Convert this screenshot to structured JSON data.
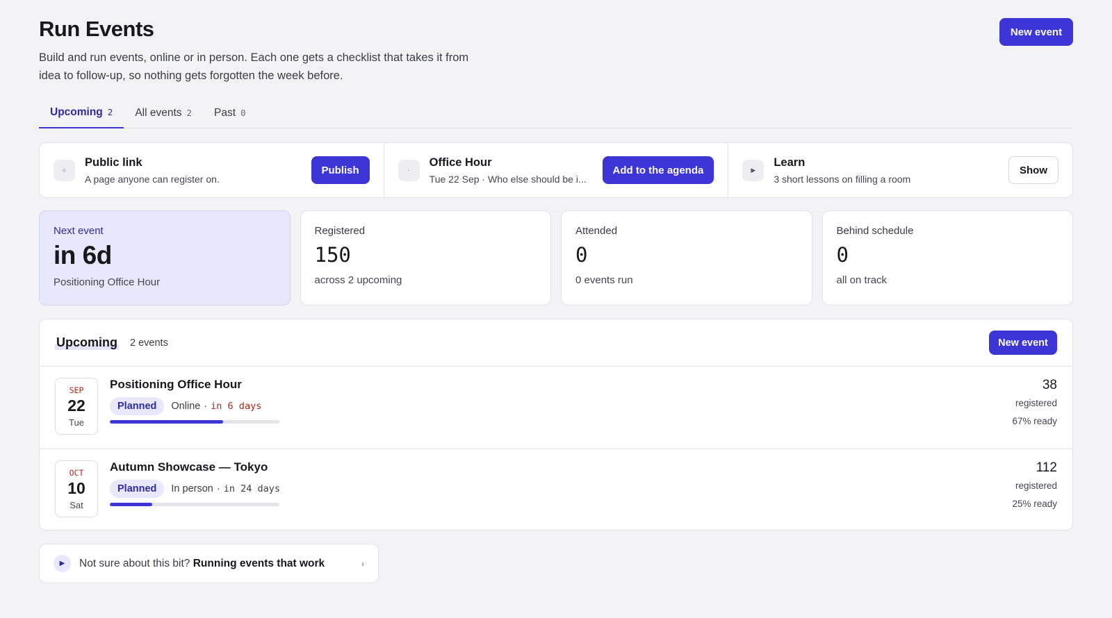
{
  "header": {
    "title": "Run Events",
    "description": "Build and run events, online or in person. Each one gets a checklist that takes it from idea to follow-up, so nothing gets forgotten the week before.",
    "new_event_label": "New event"
  },
  "tabs": [
    {
      "label": "Upcoming",
      "count": "2",
      "active": true
    },
    {
      "label": "All events",
      "count": "2",
      "active": false
    },
    {
      "label": "Past",
      "count": "0",
      "active": false
    }
  ],
  "action_strip": [
    {
      "icon": "circle-icon",
      "glyph": "○",
      "title": "Public link",
      "subtitle": "A page anyone can register on.",
      "button": "Publish",
      "button_style": "primary"
    },
    {
      "icon": "dot-icon",
      "glyph": "·",
      "title": "Office Hour",
      "subtitle": "Tue 22 Sep · Who else should be i...",
      "button": "Add to the agenda",
      "button_style": "primary"
    },
    {
      "icon": "play-icon",
      "glyph": "▶",
      "title": "Learn",
      "subtitle": "3 short lessons on filling a room",
      "button": "Show",
      "button_style": "secondary"
    }
  ],
  "stats": {
    "next_event": {
      "label": "Next event",
      "value": "in 6d",
      "sub": "Positioning Office Hour"
    },
    "registered": {
      "label": "Registered",
      "value": "150",
      "sub": "across 2 upcoming"
    },
    "attended": {
      "label": "Attended",
      "value": "0",
      "sub": "0 events run"
    },
    "behind": {
      "label": "Behind schedule",
      "value": "0",
      "sub": "all on track"
    }
  },
  "upcoming_panel": {
    "title": "Upcoming",
    "count": "2 events",
    "new_event_label": "New event",
    "events": [
      {
        "month": "SEP",
        "day": "22",
        "weekday": "Tue",
        "title": "Positioning Office Hour",
        "status": "Planned",
        "format": "Online",
        "when": "in 6 days",
        "progress": 0.67,
        "registered": "38",
        "registered_label": "registered",
        "ready": "67% ready"
      },
      {
        "month": "OCT",
        "day": "10",
        "weekday": "Sat",
        "title": "Autumn Showcase — Tokyo",
        "status": "Planned",
        "format": "In person",
        "when": "in 24 days",
        "progress": 0.25,
        "registered": "112",
        "registered_label": "registered",
        "ready": "25% ready"
      }
    ]
  },
  "help": {
    "icon": "play-icon",
    "prompt": "Not sure about this bit?",
    "link": "Running events that work"
  },
  "colors": {
    "accent": "#3d35d6",
    "accent_soft": "#e8e7fb",
    "urgent": "#b3261e",
    "background": "#f3f3f6"
  }
}
